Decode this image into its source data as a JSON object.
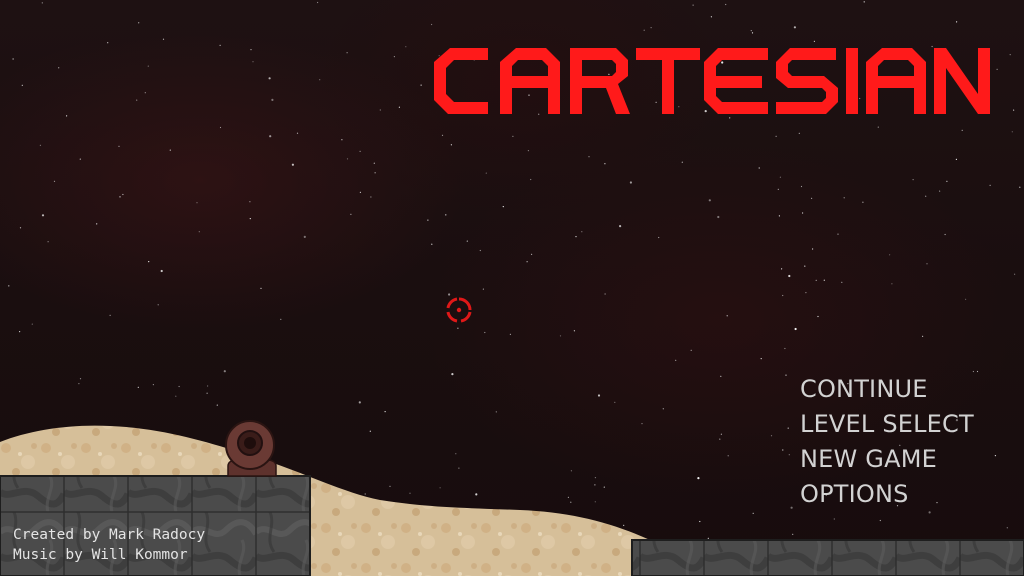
{
  "game": {
    "title": "CARTESIAN",
    "title_color": "#ff1a1a"
  },
  "menu": {
    "items": [
      {
        "label": "CONTINUE"
      },
      {
        "label": "LEVEL SELECT"
      },
      {
        "label": "NEW GAME"
      },
      {
        "label": "OPTIONS"
      }
    ],
    "text_color": "#d2d2d2"
  },
  "credits": {
    "line1": "Created by Mark Radocy",
    "line2": "Music by Will Kommor"
  },
  "colors": {
    "background": "#1b0f10",
    "reticle": "#e01818",
    "sand": "#d8c09a",
    "stone": "#4a4a4a",
    "cannon": "#6a3a34"
  },
  "icons": {
    "reticle": "crosshair-icon",
    "cannon": "cannon-icon"
  }
}
